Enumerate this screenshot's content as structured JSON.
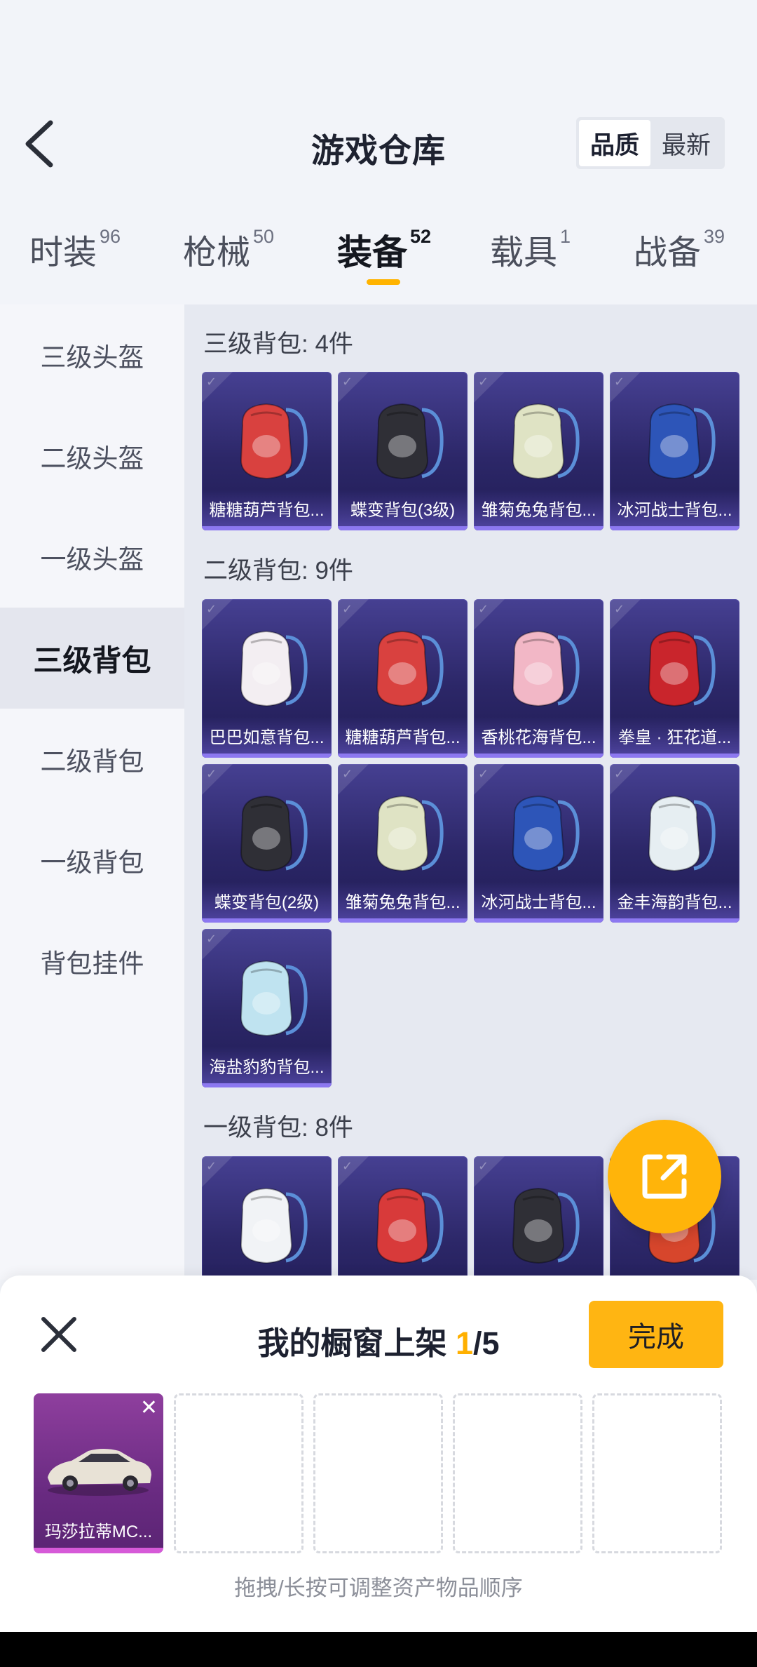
{
  "header": {
    "title": "游戏仓库",
    "sort": {
      "quality": "品质",
      "newest": "最新",
      "active": "quality"
    }
  },
  "tabs": [
    {
      "label": "时装",
      "count": "96"
    },
    {
      "label": "枪械",
      "count": "50"
    },
    {
      "label": "装备",
      "count": "52"
    },
    {
      "label": "载具",
      "count": "1"
    },
    {
      "label": "战备",
      "count": "39"
    }
  ],
  "sidebar": [
    "三级头盔",
    "二级头盔",
    "一级头盔",
    "三级背包",
    "二级背包",
    "一级背包",
    "背包挂件"
  ],
  "sections": [
    {
      "title": "三级背包: 4件",
      "items": [
        {
          "name": "糖糖葫芦背包...",
          "icon": "candy-gourd-backpack-icon",
          "color": "#d9413f"
        },
        {
          "name": "蝶变背包(3级)",
          "icon": "butterfly-backpack-icon",
          "color": "#2f2f36"
        },
        {
          "name": "雏菊兔兔背包...",
          "icon": "daisy-bunny-backpack-icon",
          "color": "#dfe3c4"
        },
        {
          "name": "冰河战士背包...",
          "icon": "glacier-warrior-backpack-icon",
          "color": "#2d55b8"
        }
      ]
    },
    {
      "title": "二级背包: 9件",
      "items": [
        {
          "name": "巴巴如意背包...",
          "icon": "baba-ruyi-backpack-icon",
          "color": "#f3eef2"
        },
        {
          "name": "糖糖葫芦背包...",
          "icon": "candy-gourd-backpack-icon",
          "color": "#d9413f"
        },
        {
          "name": "香桃花海背包...",
          "icon": "peach-blossom-backpack-icon",
          "color": "#f2b7c6"
        },
        {
          "name": "拳皇 · 狂花道...",
          "icon": "kof-flower-backpack-icon",
          "color": "#c9252c"
        },
        {
          "name": "蝶变背包(2级)",
          "icon": "butterfly-backpack-icon",
          "color": "#2f2f36"
        },
        {
          "name": "雏菊兔兔背包...",
          "icon": "daisy-bunny-backpack-icon",
          "color": "#dfe3c4"
        },
        {
          "name": "冰河战士背包...",
          "icon": "glacier-warrior-backpack-icon",
          "color": "#2d55b8"
        },
        {
          "name": "金丰海韵背包...",
          "icon": "golden-sea-backpack-icon",
          "color": "#e6eef2"
        },
        {
          "name": "海盐豹豹背包...",
          "icon": "sea-salt-leopard-backpack-icon",
          "color": "#bfe3f0"
        }
      ]
    },
    {
      "title": "一级背包: 8件",
      "items": [
        {
          "name": "",
          "icon": "white-bunny-backpack-icon",
          "color": "#f1f3f6"
        },
        {
          "name": "",
          "icon": "red-backpack-icon",
          "color": "#d83a3a"
        },
        {
          "name": "",
          "icon": "black-bunny-backpack-icon",
          "color": "#2f2f36"
        },
        {
          "name": "",
          "icon": "red-round-backpack-icon",
          "color": "#d7462c"
        }
      ]
    }
  ],
  "sheet": {
    "title_prefix": "我的橱窗上架 ",
    "count": "1",
    "total": "/5",
    "done": "完成",
    "hint": "拖拽/长按可调整资产物品顺序",
    "slots": [
      {
        "name": "玛莎拉蒂MC...",
        "icon": "maserati-car-icon"
      }
    ]
  }
}
